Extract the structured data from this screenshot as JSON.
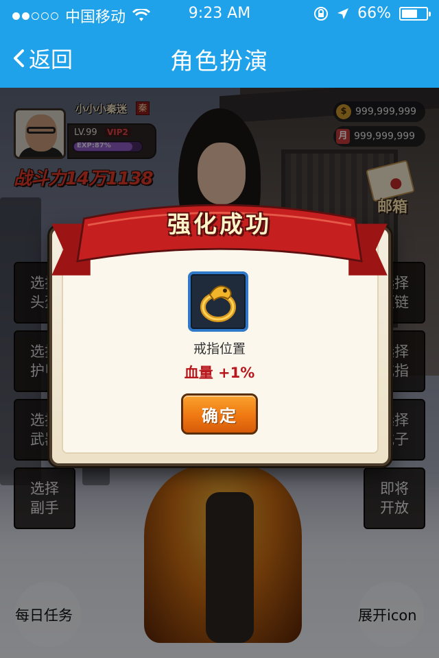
{
  "status_bar": {
    "carrier": "中国移动",
    "time": "9:23 AM",
    "battery": "66%",
    "battery_level": 0.66,
    "signal_bars_filled": 2,
    "signal_bars_total": 5
  },
  "nav": {
    "back_label": "返回",
    "title": "角色扮演"
  },
  "player": {
    "name": "小小小秦迷",
    "faction": "秦",
    "level": "LV.99",
    "vip": "VIP2",
    "exp": "EXP:87%",
    "exp_level": 0.87,
    "power": "战斗力14万1138"
  },
  "currency": {
    "gold_icon": "$",
    "gold": "999,999,999",
    "month_icon": "月",
    "month": "999,999,999"
  },
  "mail_label": "邮箱",
  "side_buttons_left": [
    {
      "line1": "选择",
      "line2": "头盔"
    },
    {
      "line1": "选择",
      "line2": "护甲"
    },
    {
      "line1": "选择",
      "line2": "武器"
    },
    {
      "line1": "选择",
      "line2": "副手"
    }
  ],
  "side_buttons_right": [
    {
      "line1": "选择",
      "line2": "项链"
    },
    {
      "line1": "选择",
      "line2": "戒指"
    },
    {
      "line1": "选择",
      "line2": "靴子"
    },
    {
      "line1": "即将",
      "line2": "开放"
    }
  ],
  "bottom": {
    "daily_tasks": "每日任务",
    "expand": "展开icon"
  },
  "dialog": {
    "title": "强化成功",
    "item_name": "戒指位置",
    "stat_label": "血量",
    "stat_value": "+1%",
    "confirm": "确定"
  },
  "colors": {
    "nav_blue": "#1fa2ea",
    "ribbon_red": "#c61f1f",
    "button_orange": "#ef7812",
    "item_border_blue": "#2f79c8"
  }
}
